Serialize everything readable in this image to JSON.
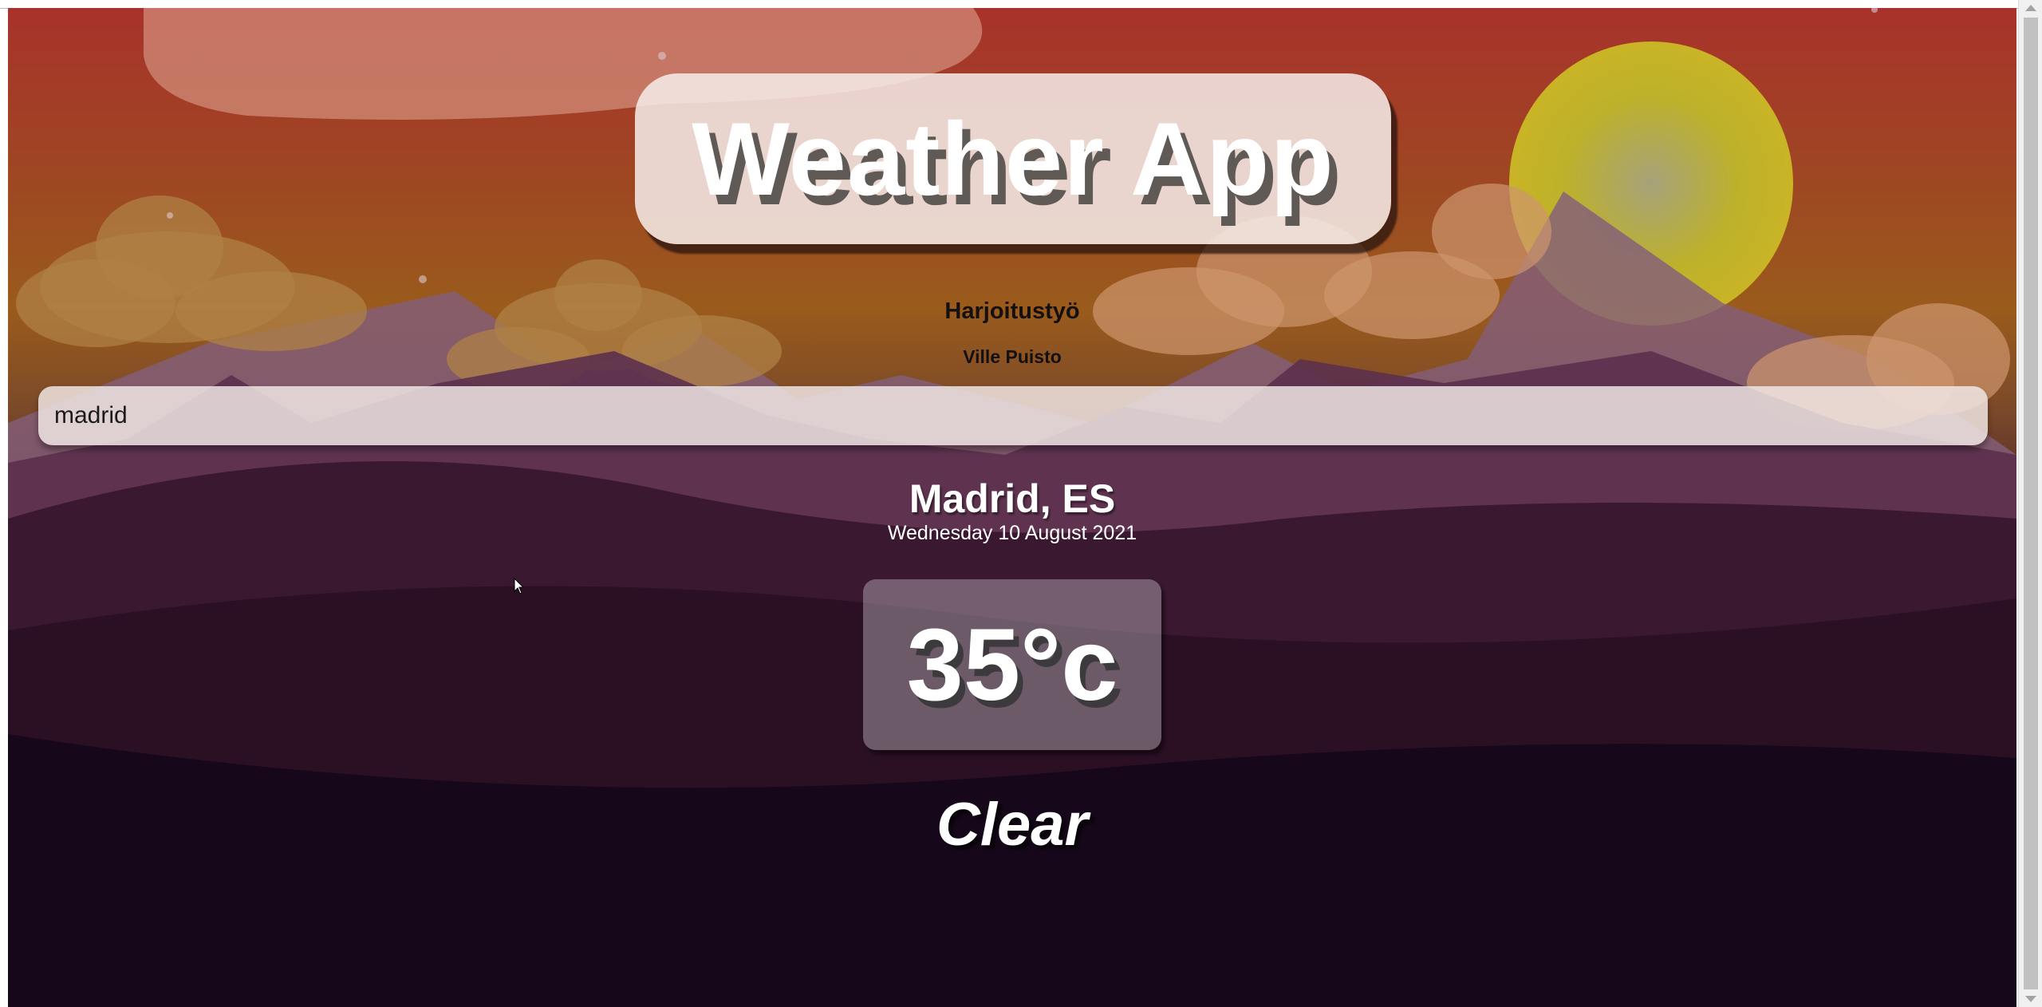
{
  "app": {
    "title": "Weather App",
    "subtitle": "Harjoitustyö",
    "author": "Ville Puisto"
  },
  "search": {
    "value": "madrid"
  },
  "weather": {
    "location": "Madrid, ES",
    "date": "Wednesday 10 August 2021",
    "temperature": "35°c",
    "condition": "Clear"
  },
  "theme": {
    "sky_top": "#a8322b",
    "sky_mid": "#9a5b1c",
    "night": "#0a0513",
    "sun": "#c8c12a",
    "mountain": "#8e6a86"
  },
  "icons": [
    "mouse-cursor-icon",
    "scroll-up-icon",
    "scroll-down-icon"
  ]
}
